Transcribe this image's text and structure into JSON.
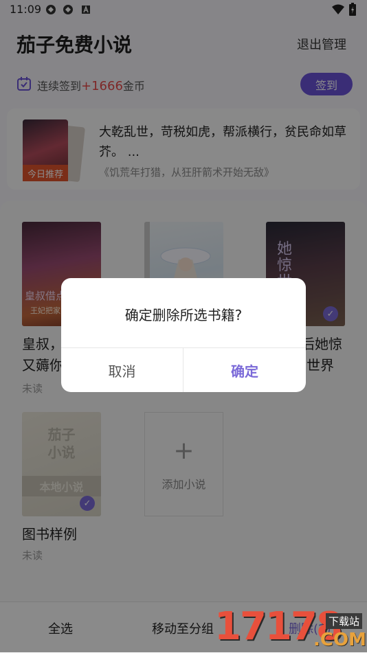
{
  "status_bar": {
    "time": "11:09"
  },
  "header": {
    "title": "茄子免费小说",
    "exit_manage": "退出管理"
  },
  "checkin": {
    "prefix": "连续签到",
    "coins": "+1666",
    "suffix": "金币",
    "button": "签到"
  },
  "recommend": {
    "badge": "今日推荐",
    "description": "大乾乱世，苛税如虎，帮派横行，贫民命如草芥。 ...",
    "source": "《饥荒年打猎，从狂肝箭术开始无敌》"
  },
  "books": [
    {
      "name_line1": "皇叔，",
      "name_line2": "又薅你",
      "status": "未读",
      "cover_title": "皇叔借点",
      "cover_sub": "王妃把家"
    },
    {
      "name_line1": "",
      "name_line2": "",
      "status": ""
    },
    {
      "name_line1": "后她惊",
      "name_line2": "世界",
      "status": "",
      "cover_title": "她惊世"
    },
    {
      "name_line1": "图书样例",
      "name_line2": "",
      "status": "未读",
      "cover_logo": "茄子小说",
      "cover_label": "本地小说"
    }
  ],
  "add_book": {
    "icon": "+",
    "label": "添加小说"
  },
  "bottom_bar": {
    "select_all": "全选",
    "move_to_group": "移动至分组",
    "delete": "删除(2)"
  },
  "dialog": {
    "title": "确定删除所选书籍?",
    "cancel": "取消",
    "confirm": "确定"
  },
  "watermark": {
    "number": "17178",
    "site": "下载站",
    "domain": ".COM"
  },
  "colors": {
    "accent": "#6a52d8",
    "coins": "#e54848",
    "badge": "#e0542c"
  }
}
